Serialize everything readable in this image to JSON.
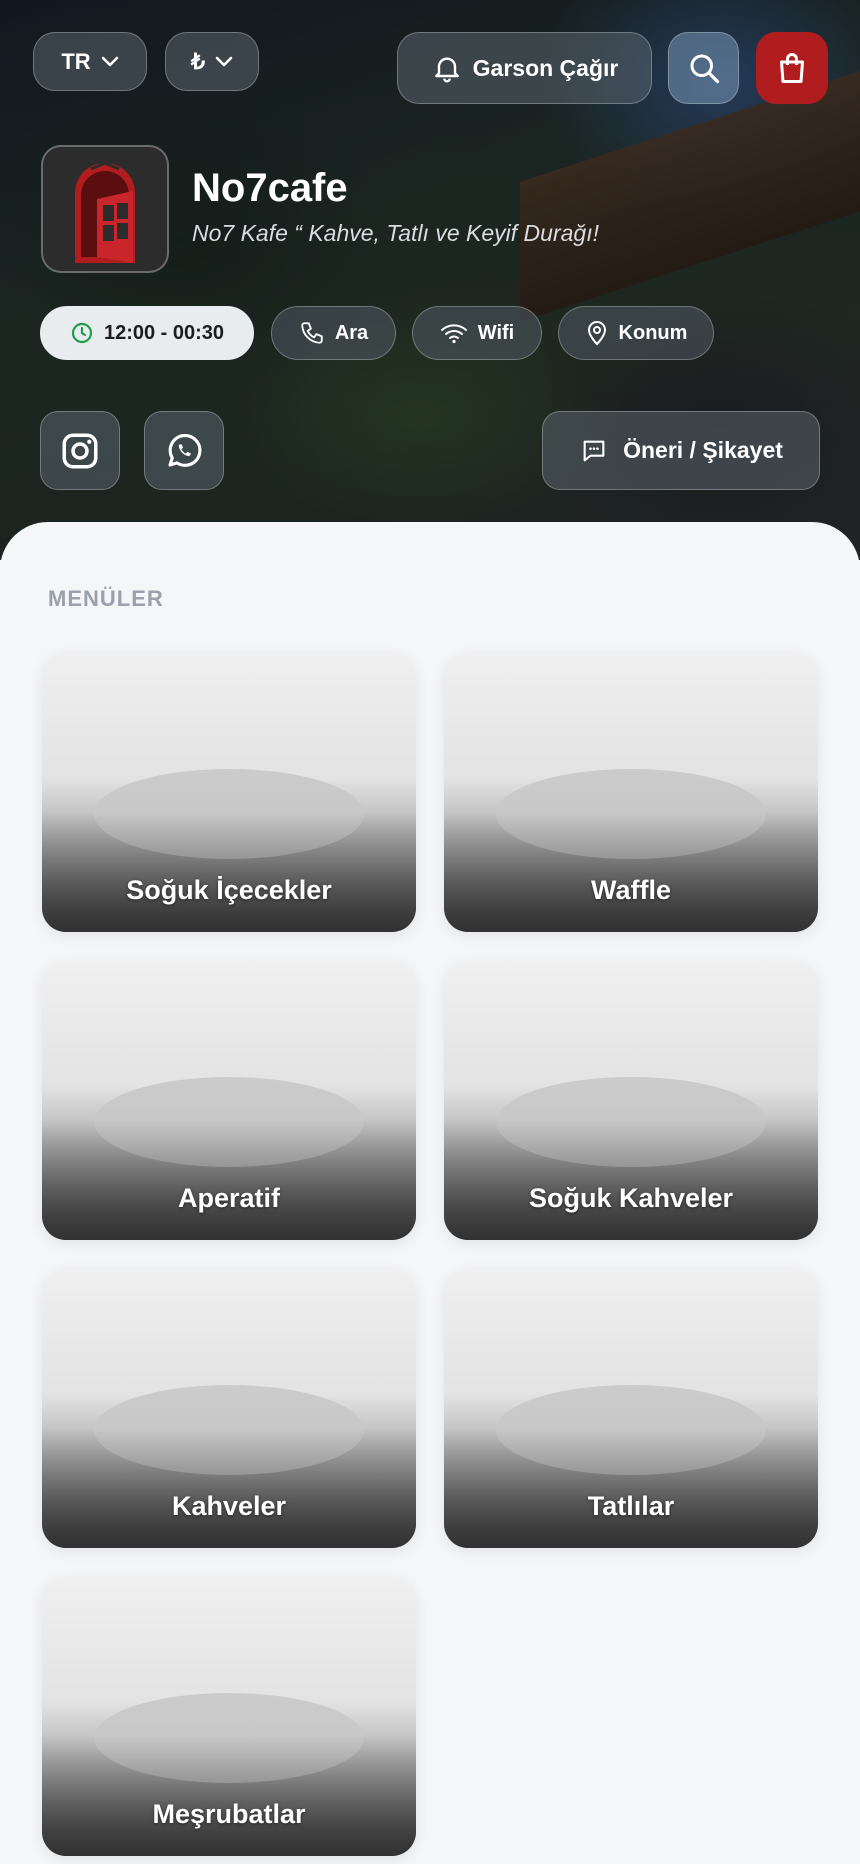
{
  "header": {
    "language": "TR",
    "currency": "₺",
    "waiter_button": "Garson Çağır"
  },
  "cafe": {
    "name": "No7cafe",
    "tagline": "No7 Kafe “ Kahve, Tatlı ve Keyif Durağı!"
  },
  "info": {
    "hours": "12:00 - 00:30",
    "call": "Ara",
    "wifi": "Wifi",
    "location": "Konum"
  },
  "actions": {
    "feedback": "Öneri / Şikayet"
  },
  "menus": {
    "section_title": "MENÜLER",
    "items": [
      {
        "label": "Soğuk İçecekler"
      },
      {
        "label": "Waffle"
      },
      {
        "label": "Aperatif"
      },
      {
        "label": "Soğuk Kahveler"
      },
      {
        "label": "Kahveler"
      },
      {
        "label": "Tatlılar"
      },
      {
        "label": "Meşrubatlar"
      }
    ]
  },
  "colors": {
    "brand_red": "#b11d1e",
    "clock_green": "#1e9e4a",
    "section_gray": "#9aa1ab"
  }
}
